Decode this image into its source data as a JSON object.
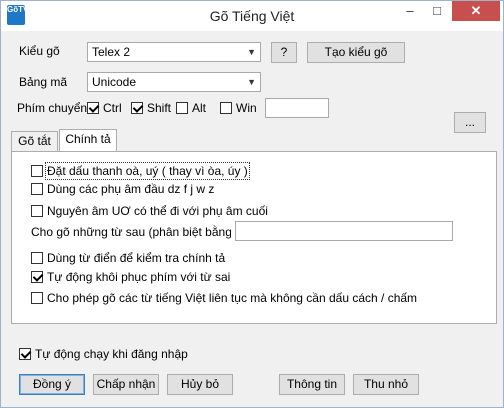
{
  "window": {
    "title": "Gõ Tiếng Việt",
    "icon_text_top": "GõTV",
    "min": "–",
    "max": "□",
    "close": "✕"
  },
  "input_method": {
    "label": "Kiểu gõ",
    "value": "Telex 2",
    "help_label": "?",
    "create_label": "Tạo kiểu gõ"
  },
  "charset": {
    "label": "Bảng mã",
    "value": "Unicode"
  },
  "hotkey": {
    "label": "Phím chuyển",
    "ctrl": {
      "label": "Ctrl",
      "checked": true
    },
    "shift": {
      "label": "Shift",
      "checked": true
    },
    "alt": {
      "label": "Alt",
      "checked": false
    },
    "win": {
      "label": "Win",
      "checked": false
    },
    "key_value": ""
  },
  "more_button": "...",
  "tabs": [
    {
      "label": "Gõ tắt",
      "active": false
    },
    {
      "label": "Chính tả",
      "active": true
    }
  ],
  "options": [
    {
      "label": "Đặt dấu thanh oà, uý ( thay vì òa, úy )",
      "checked": false
    },
    {
      "label": "Dùng các phụ âm đầu dz f j w z",
      "checked": false
    },
    {
      "label": "Nguyên âm UƠ có thể đi với phụ âm cuối",
      "checked": false
    }
  ],
  "exceptions": {
    "label": "Cho gõ những từ sau (phân biệt bằng ...",
    "value": ""
  },
  "options2": [
    {
      "label": "Dùng từ điển để kiểm tra chính tả",
      "checked": false
    },
    {
      "label": "Tự động khôi phục phím với từ sai",
      "checked": true
    },
    {
      "label": "Cho phép gõ các từ tiếng Việt liên tục mà không cần dấu cách / chấm",
      "checked": false
    }
  ],
  "autostart": {
    "label": "Tự động chạy khi đăng nhập",
    "checked": true
  },
  "buttons": {
    "ok": "Đồng ý",
    "apply": "Chấp nhận",
    "cancel": "Hủy bỏ",
    "info": "Thông tin",
    "minimize": "Thu nhỏ"
  }
}
